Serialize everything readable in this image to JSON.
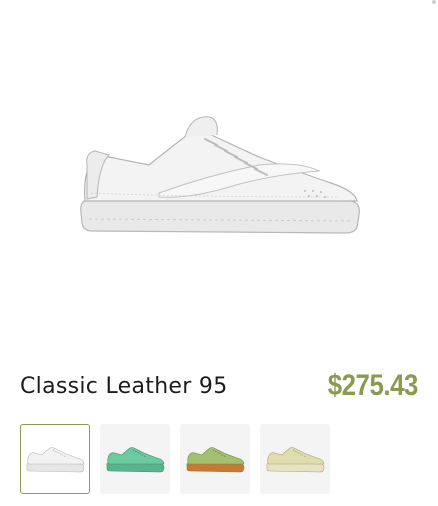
{
  "product": {
    "name": "Classic Leather 95",
    "price": "$275.43"
  },
  "colors": {
    "accent": "#8a9a4e",
    "text": "#1c1c1c"
  },
  "variants": [
    {
      "name": "white",
      "upper": "#f2f2f2",
      "sole": "#e6e6e6",
      "outline": "#b8b8b8",
      "selected": true
    },
    {
      "name": "mint",
      "upper": "#6ccaa0",
      "sole": "#5ab38c",
      "outline": "#3f8f6c",
      "selected": false
    },
    {
      "name": "lime-gum",
      "upper": "#a3c06e",
      "sole": "#c67a36",
      "outline": "#6f8a46",
      "selected": false
    },
    {
      "name": "cream",
      "upper": "#dfdcae",
      "sole": "#e8e2c2",
      "outline": "#a8a47a",
      "selected": false
    }
  ]
}
